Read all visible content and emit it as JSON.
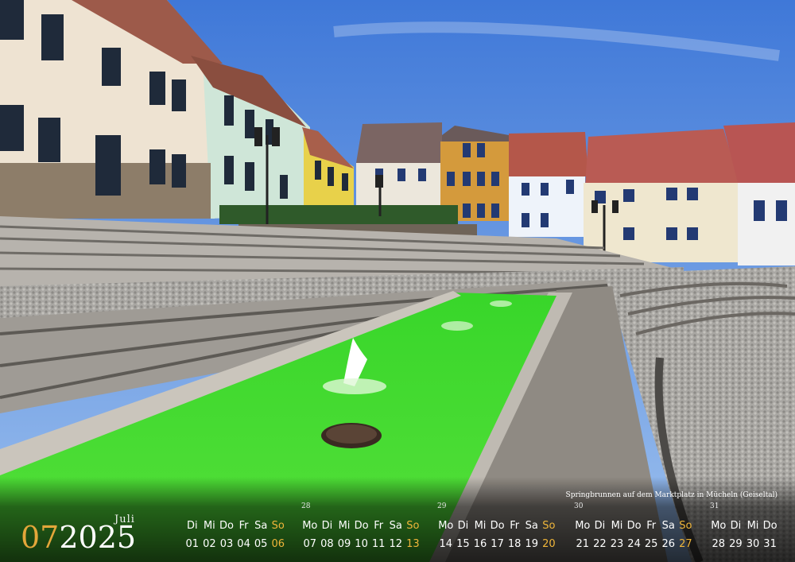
{
  "caption": "Springbrunnen auf dem Marktplatz in Mücheln (Geiseltal)",
  "month_name": "Juli",
  "month_number": "07",
  "year": "2025",
  "colors": {
    "accent": "#e3a63a",
    "sunday": "#f0b63a",
    "water": "#4bd92a",
    "sky": "#5b8bd6"
  },
  "weeks": [
    {
      "kw": "",
      "days": [
        "Di",
        "Mi",
        "Do",
        "Fr",
        "Sa",
        "So"
      ],
      "nums": [
        "01",
        "02",
        "03",
        "04",
        "05",
        "06"
      ]
    },
    {
      "kw": "28",
      "days": [
        "Mo",
        "Di",
        "Mi",
        "Do",
        "Fr",
        "Sa",
        "So"
      ],
      "nums": [
        "07",
        "08",
        "09",
        "10",
        "11",
        "12",
        "13"
      ]
    },
    {
      "kw": "29",
      "days": [
        "Mo",
        "Di",
        "Mi",
        "Do",
        "Fr",
        "Sa",
        "So"
      ],
      "nums": [
        "14",
        "15",
        "16",
        "17",
        "18",
        "19",
        "20"
      ]
    },
    {
      "kw": "30",
      "days": [
        "Mo",
        "Di",
        "Mi",
        "Do",
        "Fr",
        "Sa",
        "So"
      ],
      "nums": [
        "21",
        "22",
        "23",
        "24",
        "25",
        "26",
        "27"
      ]
    },
    {
      "kw": "31",
      "days": [
        "Mo",
        "Di",
        "Mi",
        "Do"
      ],
      "nums": [
        "28",
        "29",
        "30",
        "31"
      ]
    }
  ]
}
